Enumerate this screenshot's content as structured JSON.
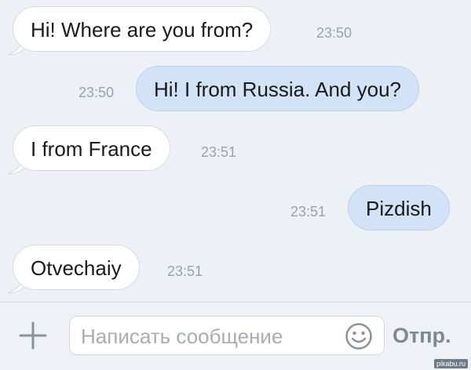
{
  "messages": [
    {
      "text": "Hi! Where are you from?",
      "time": "23:50",
      "direction": "in"
    },
    {
      "text": "Hi! I from Russia. And you?",
      "time": "23:50",
      "direction": "out"
    },
    {
      "text": "I from France",
      "time": "23:51",
      "direction": "in"
    },
    {
      "text": "Pizdish",
      "time": "23:51",
      "direction": "out"
    },
    {
      "text": "Otvechaiy",
      "time": "23:51",
      "direction": "in"
    }
  ],
  "composer": {
    "placeholder": "Написать сообщение",
    "send_label": "Отпр.",
    "attach_icon": "plus-icon",
    "emoji_icon": "smiley-icon"
  },
  "watermark": "pikabu.ru",
  "colors": {
    "background": "#edf1f6",
    "incoming_bubble": "#ffffff",
    "outgoing_bubble": "#d2e2f7"
  }
}
